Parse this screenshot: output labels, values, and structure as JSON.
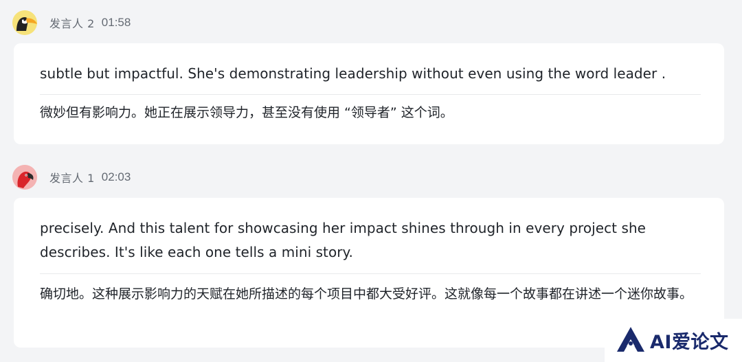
{
  "messages": [
    {
      "speaker": "发言人 2",
      "time": "01:58",
      "avatar": "toucan-icon",
      "english": "subtle but impactful. She's demonstrating leadership without even using the word leader .",
      "chinese": "微妙但有影响力。她正在展示领导力，甚至没有使用 “领导者” 这个词。"
    },
    {
      "speaker": "发言人 1",
      "time": "02:03",
      "avatar": "parrot-icon",
      "english": "precisely. And this talent for showcasing her impact shines through in every project she describes. It's like each one tells a mini story.",
      "chinese": "确切地。这种展示影响力的天赋在她所描述的每个项目中都大受好评。这就像每一个故事都在讲述一个迷你故事。"
    }
  ],
  "watermark": {
    "text": "AI爱论文",
    "icon": "ai-logo-icon"
  },
  "colors": {
    "background": "#f3f4f6",
    "card": "#ffffff",
    "meta_text": "#646a73",
    "watermark_text": "#1a2a6c"
  }
}
